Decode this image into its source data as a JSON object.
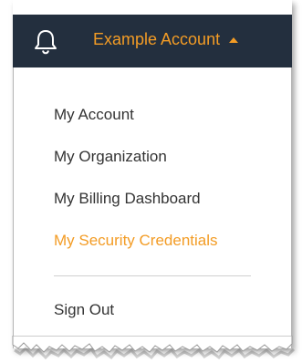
{
  "header": {
    "partial_title": "(---)",
    "notification_icon": "bell-icon",
    "account_label": "Example Account",
    "account_caret_icon": "caret-up-icon"
  },
  "menu": {
    "items": [
      {
        "label": "My Account"
      },
      {
        "label": "My Organization"
      },
      {
        "label": "My Billing Dashboard"
      },
      {
        "label": "My Security Credentials",
        "active": true
      },
      {
        "label": "Sign Out"
      }
    ]
  },
  "colors": {
    "topbar": "#232f3e",
    "accent": "#f39c25",
    "text": "#333333"
  }
}
